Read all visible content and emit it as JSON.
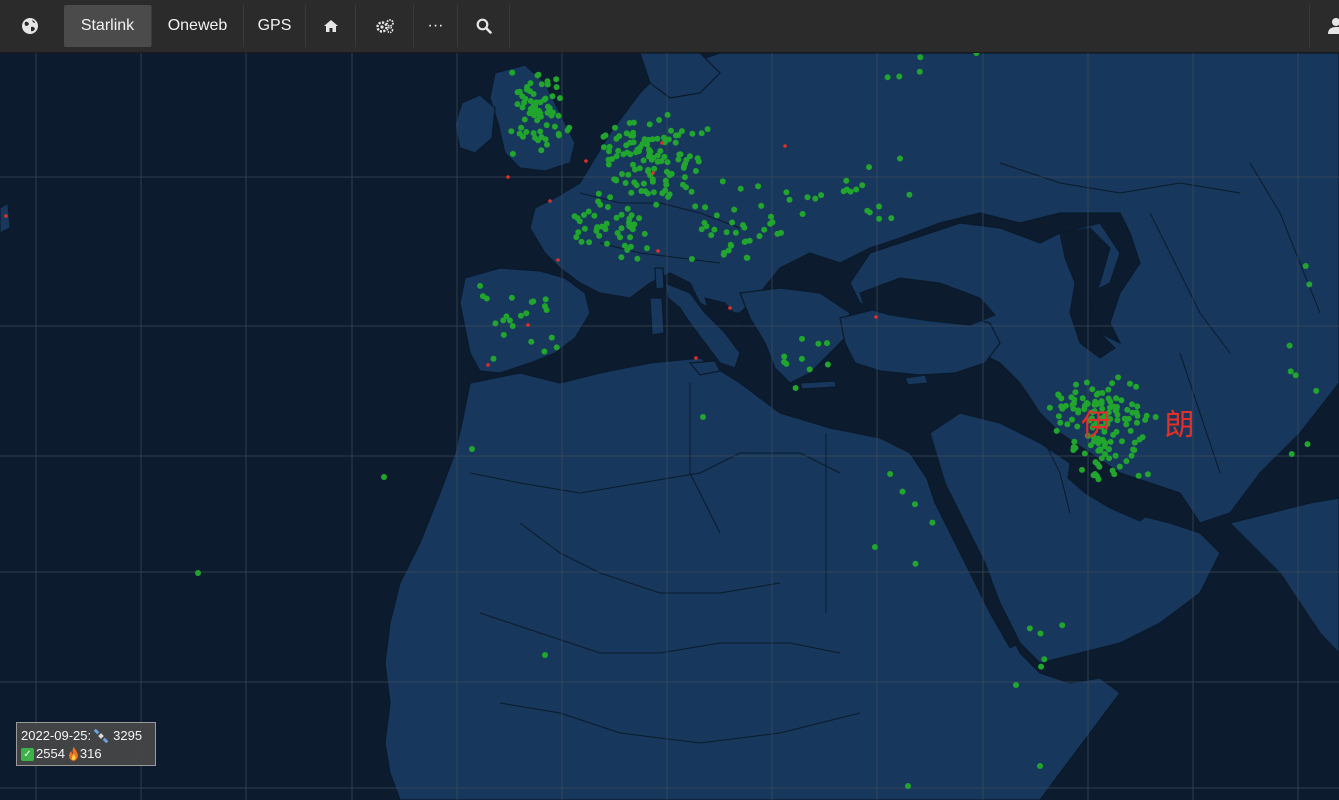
{
  "navbar": {
    "logo_icon": "globe-icon",
    "tabs": [
      {
        "label": "Starlink",
        "active": true
      },
      {
        "label": "Oneweb",
        "active": false
      },
      {
        "label": "GPS",
        "active": false
      }
    ],
    "home_icon": "home-icon",
    "settings_icon": "gears-icon",
    "more_label": "···",
    "search_icon": "search-icon",
    "user_icon": "user-icon"
  },
  "map": {
    "region_label": "伊 朗",
    "colors": {
      "ocean": "#0c1c2e",
      "land": "#17385c",
      "borders": "#0a1a2c",
      "grid": "#3a4a5a",
      "satellite_active": "#22a52e",
      "satellite_reentry": "#e0302a",
      "label": "#e0302a"
    }
  },
  "status": {
    "date_line": "2022-09-25: ",
    "total_icon": "satellite-icon",
    "total": "3295",
    "active_icon": "check-icon",
    "active": "2554",
    "reentry_icon": "fire-icon",
    "reentry": "316"
  }
}
